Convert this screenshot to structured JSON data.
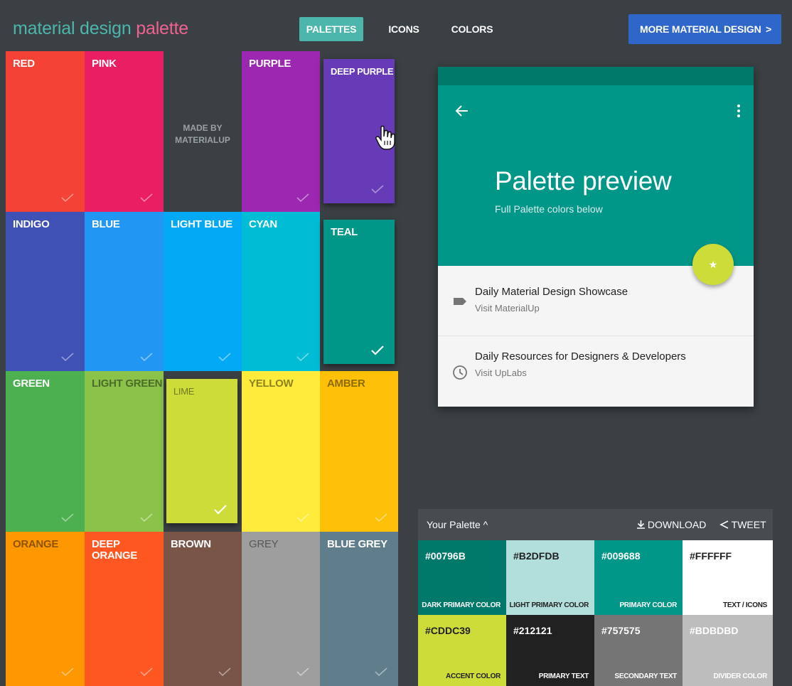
{
  "header": {
    "brand_part1": "material design",
    "brand_part2": "palette",
    "nav": [
      "PALETTES",
      "ICONS",
      "COLORS"
    ],
    "cta_label": "MORE MATERIAL DESIGN",
    "cta_chevron": ">"
  },
  "tiles": [
    {
      "label": "RED",
      "color": "#f44336"
    },
    {
      "label": "PINK",
      "color": "#e91e63"
    },
    {
      "label": "",
      "color": "#3b4044"
    },
    {
      "label": "PURPLE",
      "color": "#9c27b0"
    },
    {
      "label": "DEEP PURPLE",
      "color": "#673ab7"
    },
    {
      "label": "INDIGO",
      "color": "#3f51b5"
    },
    {
      "label": "BLUE",
      "color": "#2196f3"
    },
    {
      "label": "LIGHT BLUE",
      "color": "#03a9f4"
    },
    {
      "label": "CYAN",
      "color": "#00bcd4"
    },
    {
      "label": "TEAL",
      "color": "#009688"
    },
    {
      "label": "GREEN",
      "color": "#4caf50"
    },
    {
      "label": "LIGHT GREEN",
      "color": "#8bc34a"
    },
    {
      "label": "LIME",
      "color": "#cddc39"
    },
    {
      "label": "YELLOW",
      "color": "#ffeb3b"
    },
    {
      "label": "AMBER",
      "color": "#ffc107"
    },
    {
      "label": "ORANGE",
      "color": "#ff9800"
    },
    {
      "label": "DEEP\nORANGE",
      "color": "#ff5722"
    },
    {
      "label": "BROWN",
      "color": "#795548"
    },
    {
      "label": "GREY",
      "color": "#9e9e9e"
    },
    {
      "label": "BLUE GREY",
      "color": "#607d8b"
    }
  ],
  "made_by": "MADE BY\nMATERIALUP",
  "selected_tiles": [
    "TEAL",
    "LIME"
  ],
  "preview": {
    "title": "Palette preview",
    "subtitle": "Full Palette colors below",
    "fab_icon": "star-icon",
    "items": [
      {
        "title": "Daily Material Design Showcase",
        "subtitle": "Visit MaterialUp",
        "icon": "label-icon"
      },
      {
        "title": "Daily Resources for Designers & Developers",
        "subtitle": "Visit UpLabs",
        "icon": "clock-icon"
      }
    ]
  },
  "your_palette": {
    "title": "Your Palette ^",
    "download": "DOWNLOAD",
    "tweet": "TWEET",
    "swatches": [
      {
        "hex": "#00796B",
        "role": "DARK PRIMARY COLOR",
        "bg": "#00796b",
        "fg": "#ffffff"
      },
      {
        "hex": "#B2DFDB",
        "role": "LIGHT PRIMARY COLOR",
        "bg": "#b2dfdb",
        "fg": "#212121"
      },
      {
        "hex": "#009688",
        "role": "PRIMARY COLOR",
        "bg": "#009688",
        "fg": "#ffffff"
      },
      {
        "hex": "#FFFFFF",
        "role": "TEXT / ICONS",
        "bg": "#ffffff",
        "fg": "#212121"
      },
      {
        "hex": "#CDDC39",
        "role": "ACCENT COLOR",
        "bg": "#cddc39",
        "fg": "#212121"
      },
      {
        "hex": "#212121",
        "role": "PRIMARY TEXT",
        "bg": "#212121",
        "fg": "#ffffff"
      },
      {
        "hex": "#757575",
        "role": "SECONDARY TEXT",
        "bg": "#757575",
        "fg": "#ffffff"
      },
      {
        "hex": "#BDBDBD",
        "role": "DIVIDER COLOR",
        "bg": "#bdbdbd",
        "fg": "#ffffff"
      }
    ]
  }
}
